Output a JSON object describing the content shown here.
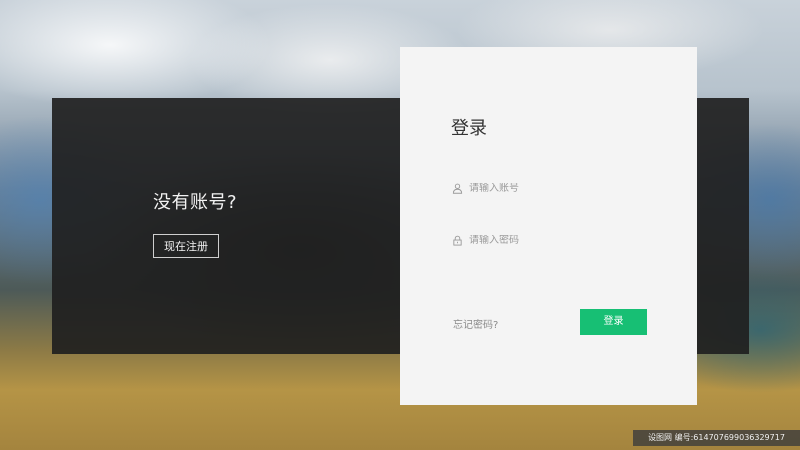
{
  "signup_panel": {
    "prompt": "没有账号?",
    "register_label": "现在注册"
  },
  "login_card": {
    "title": "登录",
    "account_placeholder": "请输入账号",
    "password_placeholder": "请输入密码",
    "account_icon": "user-icon",
    "password_icon": "lock-icon",
    "forgot_label": "忘记密码?",
    "login_label": "登录"
  },
  "colors": {
    "accent": "#17bf74",
    "dark_panel": "#202020",
    "card_background": "#f4f4f4"
  },
  "watermark": "设图网 编号:614707699036329717"
}
